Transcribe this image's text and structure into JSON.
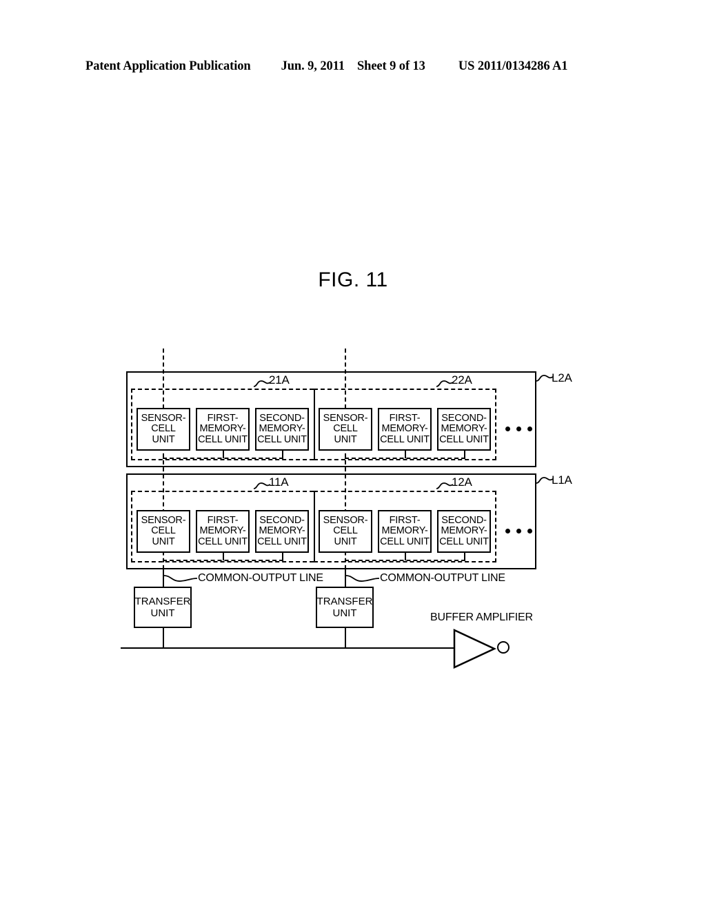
{
  "header": {
    "publication": "Patent Application Publication",
    "date": "Jun. 9, 2011",
    "sheet": "Sheet 9 of 13",
    "patent_number": "US 2011/0134286 A1"
  },
  "figure": {
    "title": "FIG. 11"
  },
  "diagram": {
    "layers": [
      {
        "id": "L2A",
        "label": "L2A",
        "groups": [
          {
            "id": "21A",
            "label": "21A",
            "cells": [
              {
                "name": "sensor-cell-unit",
                "text": "SENSOR-\nCELL\nUNIT"
              },
              {
                "name": "first-memory-cell-unit",
                "text": "FIRST-\nMEMORY-\nCELL UNIT"
              },
              {
                "name": "second-memory-cell-unit",
                "text": "SECOND-\nMEMORY-\nCELL UNIT"
              }
            ]
          },
          {
            "id": "22A",
            "label": "22A",
            "cells": [
              {
                "name": "sensor-cell-unit",
                "text": "SENSOR-\nCELL\nUNIT"
              },
              {
                "name": "first-memory-cell-unit",
                "text": "FIRST-\nMEMORY-\nCELL UNIT"
              },
              {
                "name": "second-memory-cell-unit",
                "text": "SECOND-\nMEMORY-\nCELL UNIT"
              }
            ]
          }
        ],
        "continuation": "..."
      },
      {
        "id": "L1A",
        "label": "L1A",
        "groups": [
          {
            "id": "11A",
            "label": "11A",
            "cells": [
              {
                "name": "sensor-cell-unit",
                "text": "SENSOR-\nCELL\nUNIT"
              },
              {
                "name": "first-memory-cell-unit",
                "text": "FIRST-\nMEMORY-\nCELL UNIT"
              },
              {
                "name": "second-memory-cell-unit",
                "text": "SECOND-\nMEMORY-\nCELL UNIT"
              }
            ]
          },
          {
            "id": "12A",
            "label": "12A",
            "cells": [
              {
                "name": "sensor-cell-unit",
                "text": "SENSOR-\nCELL\nUNIT"
              },
              {
                "name": "first-memory-cell-unit",
                "text": "FIRST-\nMEMORY-\nCELL UNIT"
              },
              {
                "name": "second-memory-cell-unit",
                "text": "SECOND-\nMEMORY-\nCELL UNIT"
              }
            ]
          }
        ],
        "continuation": "..."
      }
    ],
    "common_output_lines": [
      {
        "label": "COMMON-OUTPUT LINE"
      },
      {
        "label": "COMMON-OUTPUT LINE"
      }
    ],
    "transfer_units": [
      {
        "text": "TRANSFER\nUNIT"
      },
      {
        "text": "TRANSFER\nUNIT"
      }
    ],
    "buffer_amplifier": {
      "label": "BUFFER AMPLIFIER"
    }
  },
  "colors": {
    "ink": "#000000",
    "paper": "#ffffff"
  }
}
